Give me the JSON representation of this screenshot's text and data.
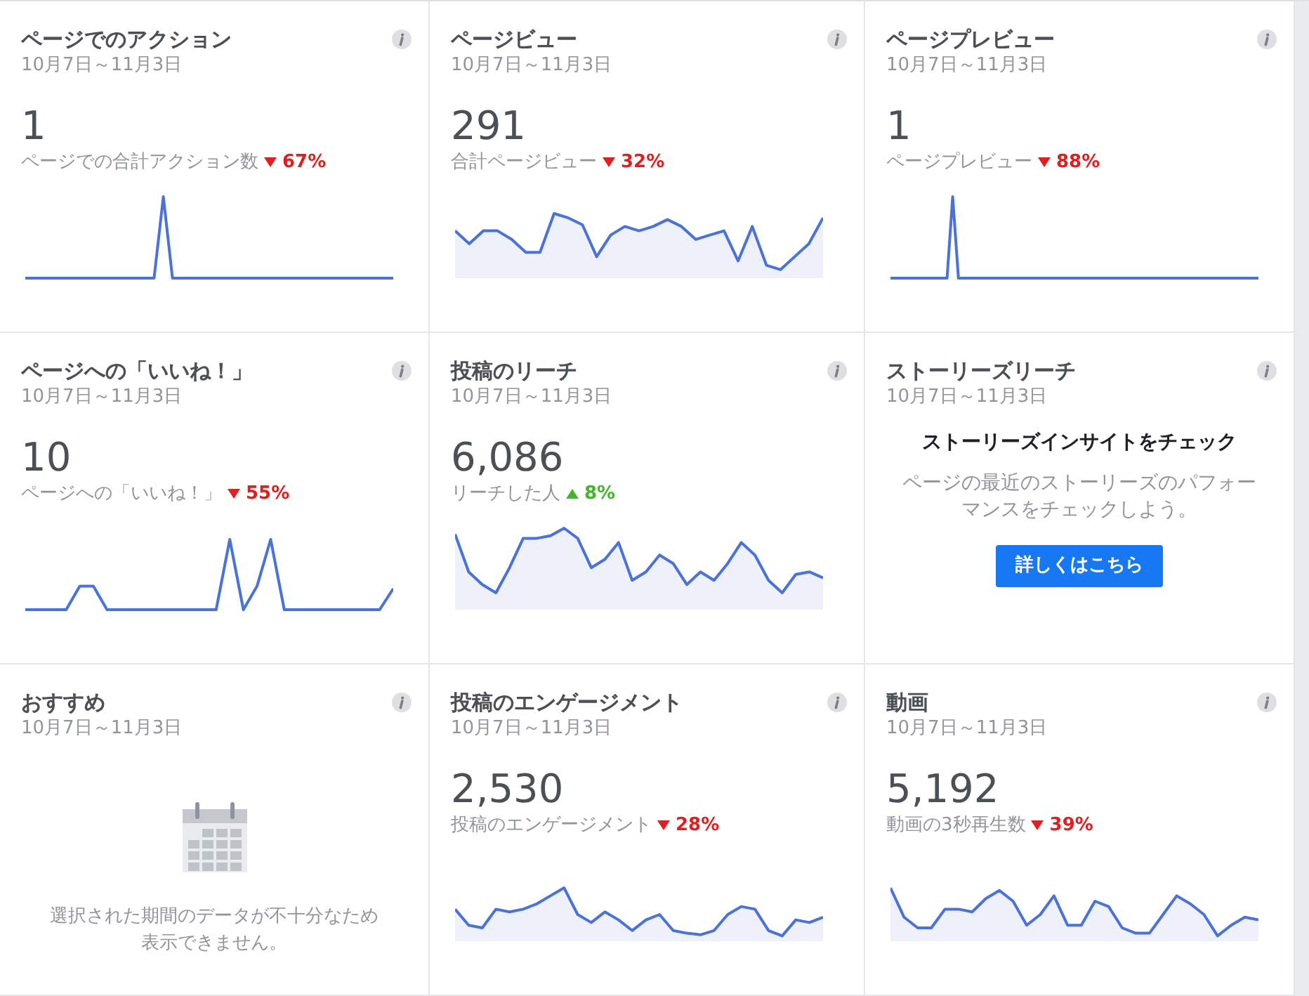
{
  "cards": [
    {
      "kind": "metric",
      "title": "ページでのアクション",
      "date": "10月7日～11月3日",
      "value": "1",
      "caption": "ページでの合計アクション数",
      "rising": false,
      "change": "67%"
    },
    {
      "kind": "metric",
      "title": "ページビュー",
      "date": "10月7日～11月3日",
      "value": "291",
      "caption": "合計ページビュー",
      "rising": false,
      "change": "32%"
    },
    {
      "kind": "metric",
      "title": "ページプレビュー",
      "date": "10月7日～11月3日",
      "value": "1",
      "caption": "ページプレビュー",
      "rising": false,
      "change": "88%"
    },
    {
      "kind": "metric",
      "title": "ページへの「いいね！」",
      "date": "10月7日～11月3日",
      "value": "10",
      "caption": "ページへの「いいね！」",
      "rising": false,
      "change": "55%"
    },
    {
      "kind": "metric",
      "title": "投稿のリーチ",
      "date": "10月7日～11月3日",
      "value": "6,086",
      "caption": "リーチした人",
      "rising": true,
      "change": "8%"
    },
    {
      "kind": "promo",
      "title": "ストーリーズリーチ",
      "date": "10月7日～11月3日",
      "heading": "ストーリーズインサイトをチェック",
      "body": "ページの最近のストーリーズのパフォーマンスをチェックしよう。",
      "button": "詳しくはこちら"
    },
    {
      "kind": "empty",
      "title": "おすすめ",
      "date": "10月7日～11月3日",
      "message": "選択された期間のデータが不十分なため表示できません。"
    },
    {
      "kind": "metric",
      "title": "投稿のエンゲージメント",
      "date": "10月7日～11月3日",
      "value": "2,530",
      "caption": "投稿のエンゲージメント",
      "rising": false,
      "change": "28%"
    },
    {
      "kind": "metric",
      "title": "動画",
      "date": "10月7日～11月3日",
      "value": "5,192",
      "caption": "動画の3秒再生数",
      "rising": false,
      "change": "39%"
    }
  ]
}
